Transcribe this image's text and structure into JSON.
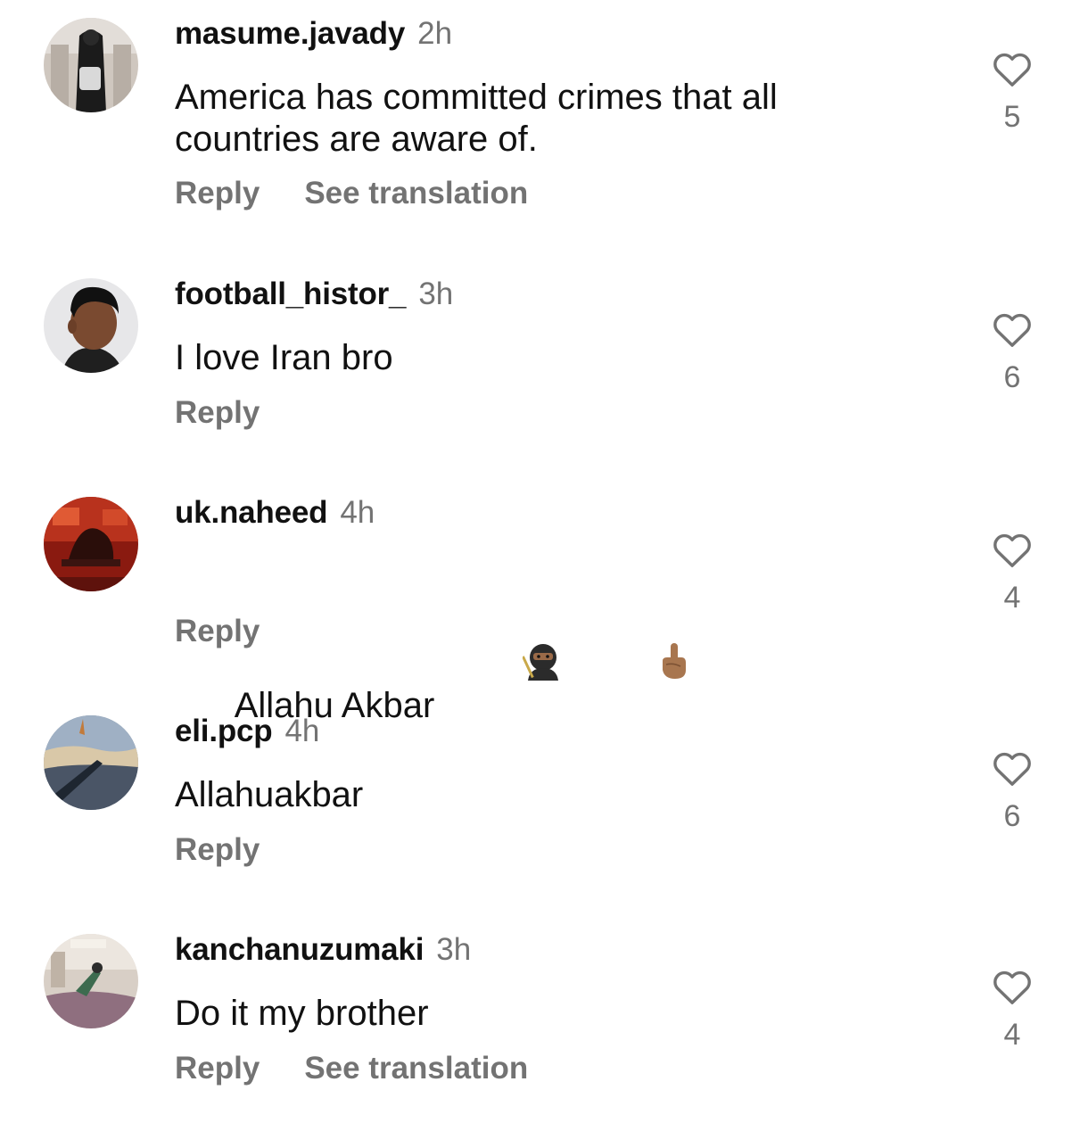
{
  "comments": [
    {
      "username": "masume.javady",
      "time": "2h",
      "text": "America has committed crimes that all\ncountries are aware of.",
      "actions": [
        "Reply",
        "See translation"
      ],
      "likes": "5"
    },
    {
      "username": "football_histor_",
      "time": "3h",
      "text": "I love Iran bro",
      "actions": [
        "Reply"
      ],
      "likes": "6"
    },
    {
      "username": "uk.naheed",
      "time": "4h",
      "text": "Allahu Akbar",
      "emoji": [
        "ninja-emoji",
        "index-pointing-up-emoji"
      ],
      "actions": [
        "Reply"
      ],
      "likes": "4"
    },
    {
      "username": "eli.pcp",
      "time": "4h",
      "text": "Allahuakbar",
      "actions": [
        "Reply"
      ],
      "likes": "6"
    },
    {
      "username": "kanchanuzumaki",
      "time": "3h",
      "text": "Do it my brother",
      "actions": [
        "Reply",
        "See translation"
      ],
      "likes": "4"
    }
  ],
  "colors": {
    "text": "#111111",
    "secondary": "#737373",
    "background": "#ffffff"
  }
}
